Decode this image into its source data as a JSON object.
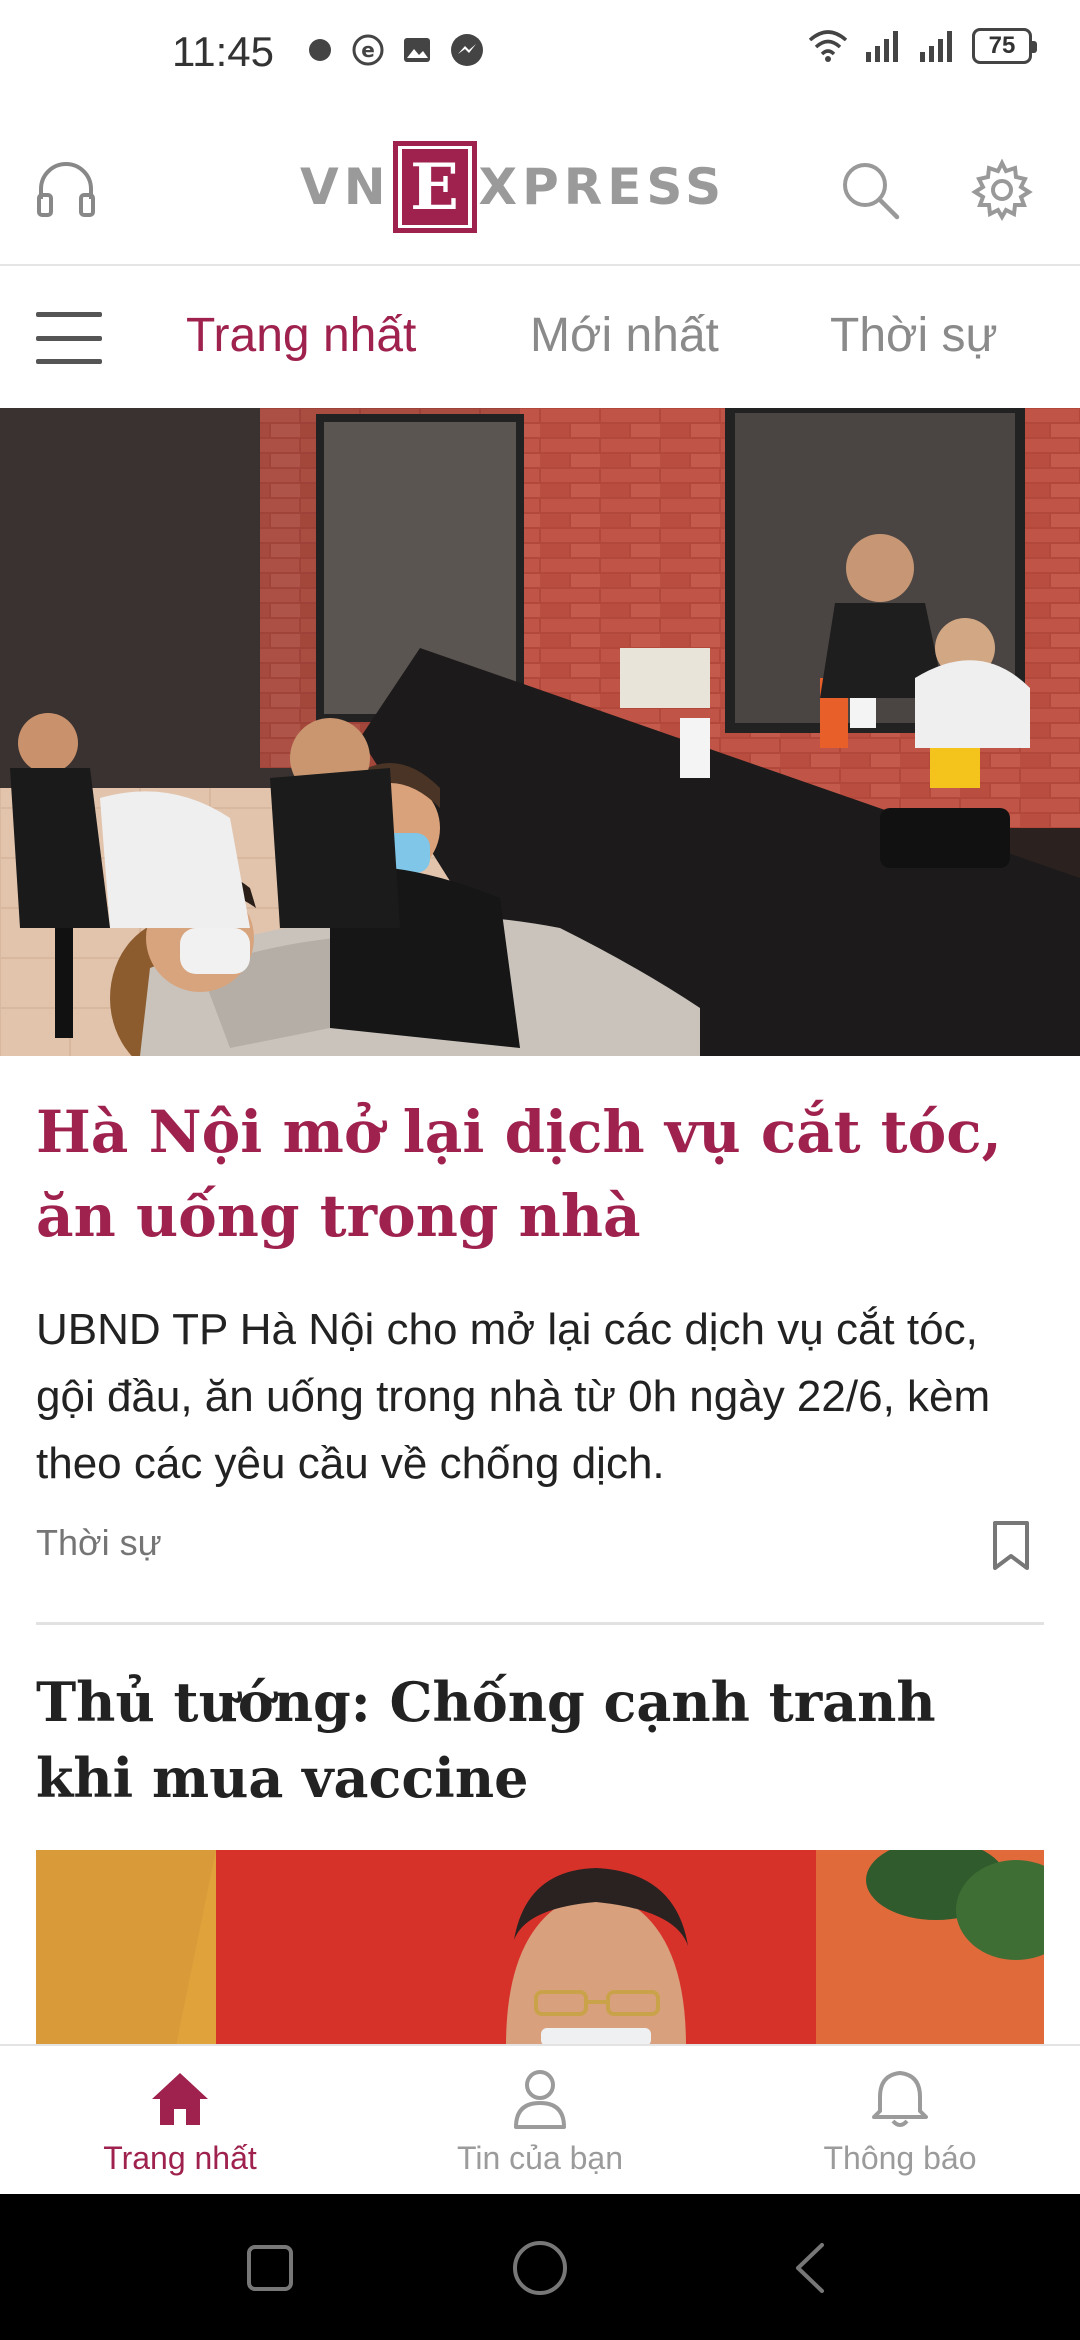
{
  "status_bar": {
    "time": "11:45",
    "battery": "75",
    "left_icons": [
      "notification-dot-icon",
      "e-app-icon",
      "gallery-icon",
      "messenger-icon"
    ],
    "right_icons": [
      "wifi-icon",
      "signal-icon",
      "signal-icon"
    ]
  },
  "header": {
    "logo_left": "VN",
    "logo_e": "E",
    "logo_right": "XPRESS",
    "icons": [
      "headphones-icon",
      "search-icon",
      "gear-icon"
    ]
  },
  "tabs": [
    {
      "label": "Trang nhất",
      "active": true
    },
    {
      "label": "Mới nhất",
      "active": false
    },
    {
      "label": "Thời sự",
      "active": false
    }
  ],
  "articles": [
    {
      "title": "Hà Nội mở lại dịch vụ cắt tóc, ăn uống trong nhà",
      "summary": "UBND TP Hà Nội cho mở lại các dịch vụ cắt tóc, gội đầu, ăn uống trong nhà từ 0h ngày 22/6, kèm theo các yêu cầu về chống dịch.",
      "category": "Thời sự"
    },
    {
      "title": "Thủ tướng: Chống cạnh tranh khi mua vaccine"
    }
  ],
  "bottom_nav": [
    {
      "label": "Trang nhất",
      "icon": "home-icon",
      "active": true
    },
    {
      "label": "Tin của bạn",
      "icon": "person-icon",
      "active": false
    },
    {
      "label": "Thông báo",
      "icon": "bell-icon",
      "active": false
    }
  ],
  "colors": {
    "brand": "#9f224e",
    "inactive": "#8a8a8a",
    "system_nav": "#000000"
  }
}
